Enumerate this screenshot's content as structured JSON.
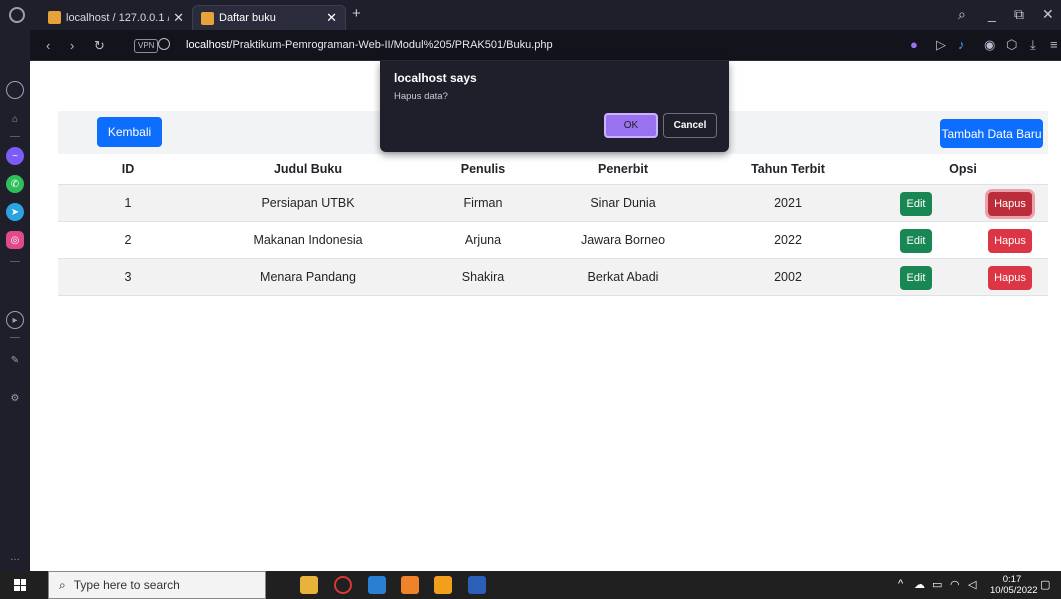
{
  "browser": {
    "tabs": [
      {
        "label": "localhost / 127.0.0.1 / prak"
      },
      {
        "label": "Daftar buku"
      }
    ],
    "vpn_label": "VPN",
    "url_host": "localhost",
    "url_path": "/Praktikum-Pemrograman-Web-II/Modul%205/PRAK501/Buku.php"
  },
  "dialog": {
    "title": "localhost says",
    "message": "Hapus data?",
    "ok_label": "OK",
    "cancel_label": "Cancel"
  },
  "toolbar": {
    "back_label": "Kembali",
    "add_label": "Tambah Data Baru"
  },
  "table": {
    "headers": [
      "ID",
      "Judul Buku",
      "Penulis",
      "Penerbit",
      "Tahun Terbit",
      "Opsi"
    ],
    "rows": [
      {
        "id": "1",
        "judul": "Persiapan UTBK",
        "penulis": "Firman",
        "penerbit": "Sinar Dunia",
        "tahun": "2021"
      },
      {
        "id": "2",
        "judul": "Makanan Indonesia",
        "penulis": "Arjuna",
        "penerbit": "Jawara Borneo",
        "tahun": "2022"
      },
      {
        "id": "3",
        "judul": "Menara Pandang",
        "penulis": "Shakira",
        "penerbit": "Berkat Abadi",
        "tahun": "2002"
      }
    ],
    "edit_label": "Edit",
    "delete_label": "Hapus"
  },
  "taskbar": {
    "search_placeholder": "Type here to search",
    "time": "0:17",
    "date": "10/05/2022"
  },
  "colors": {
    "primary": "#0d6efd",
    "success": "#198754",
    "danger": "#dc3545",
    "dialog_accent": "#9a72f0"
  }
}
